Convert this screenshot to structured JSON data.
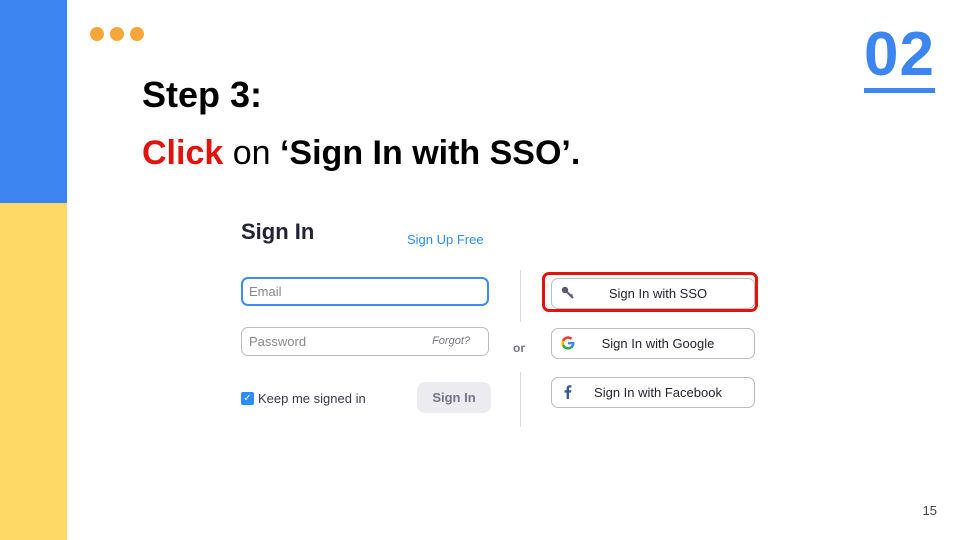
{
  "slide": {
    "number": "02",
    "page": "15",
    "step_title": "Step 3:",
    "instruction": {
      "action": "Click",
      "connector": " on ",
      "target": "‘Sign In with SSO’."
    },
    "colors": {
      "blue": "#3d85f0",
      "yellow": "#ffd966",
      "orange": "#f6a63b",
      "red": "#e0140c"
    }
  },
  "signin": {
    "title": "Sign In",
    "signup_link": "Sign Up Free",
    "email_placeholder": "Email",
    "password_placeholder": "Password",
    "forgot": "Forgot?",
    "keep_signed_in": "Keep me signed in",
    "keep_signed_in_checked": true,
    "signin_button": "Sign In",
    "or": "or",
    "sso_buttons": [
      {
        "label": "Sign In with SSO",
        "icon": "key-icon"
      },
      {
        "label": "Sign In with Google",
        "icon": "google-icon"
      },
      {
        "label": "Sign In with Facebook",
        "icon": "facebook-icon"
      }
    ]
  }
}
